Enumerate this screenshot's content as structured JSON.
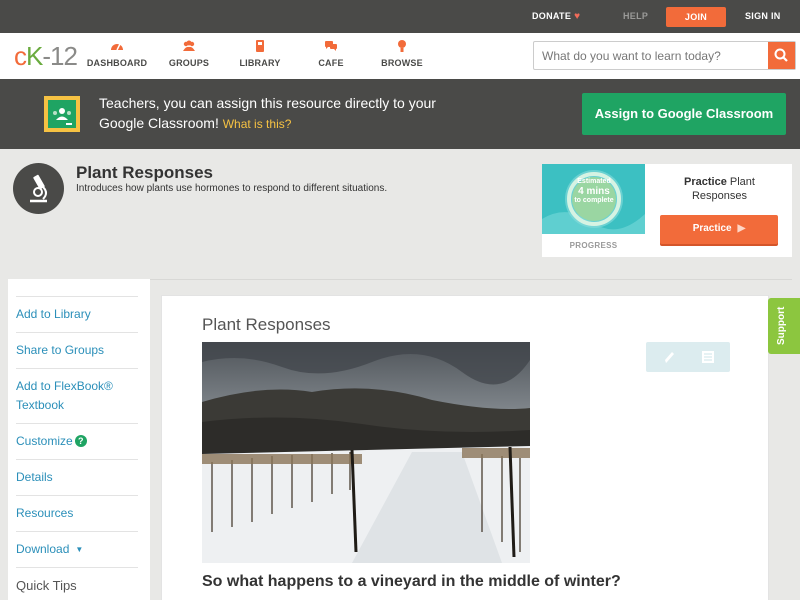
{
  "topbar": {
    "donate": "DONATE",
    "help": "HELP",
    "join": "JOIN",
    "sign_in": "SIGN IN"
  },
  "nav": {
    "logo_c": "c",
    "logo_k": "K",
    "logo_rest": "-12",
    "items": [
      {
        "label": "DASHBOARD",
        "icon": "dashboard-icon"
      },
      {
        "label": "GROUPS",
        "icon": "groups-icon"
      },
      {
        "label": "LIBRARY",
        "icon": "library-icon"
      },
      {
        "label": "CAFE",
        "icon": "cafe-icon"
      },
      {
        "label": "BROWSE",
        "icon": "browse-icon"
      }
    ],
    "search_placeholder": "What do you want to learn today?"
  },
  "banner": {
    "text": "Teachers, you can assign this resource directly to your Google Classroom!",
    "what_is_this": "What is this?",
    "assign_button": "Assign to Google Classroom"
  },
  "lesson": {
    "title": "Plant Responses",
    "description": "Introduces how plants use hormones to respond to different situations."
  },
  "practice": {
    "estimated": "Estimated",
    "mins": "4 mins",
    "to_complete": "to complete",
    "progress": "PROGRESS",
    "title_bold": "Practice",
    "title_rest": "Plant Responses",
    "button": "Practice"
  },
  "sidebar": {
    "items": [
      {
        "label": "Add to Library"
      },
      {
        "label": "Share to Groups"
      },
      {
        "label": "Add to FlexBook® Textbook"
      },
      {
        "label": "Customize"
      },
      {
        "label": "Details"
      },
      {
        "label": "Resources"
      },
      {
        "label": "Download"
      },
      {
        "label": "Quick Tips"
      }
    ]
  },
  "content": {
    "title": "Plant Responses",
    "question": "So what happens to a vineyard in the middle of winter?"
  },
  "support": "Support",
  "colors": {
    "accent_orange": "#f26b3a",
    "google_green": "#1fa463",
    "link_blue": "#2b8fb9",
    "teal": "#3cc0c2",
    "support_green": "#8cc63f"
  }
}
